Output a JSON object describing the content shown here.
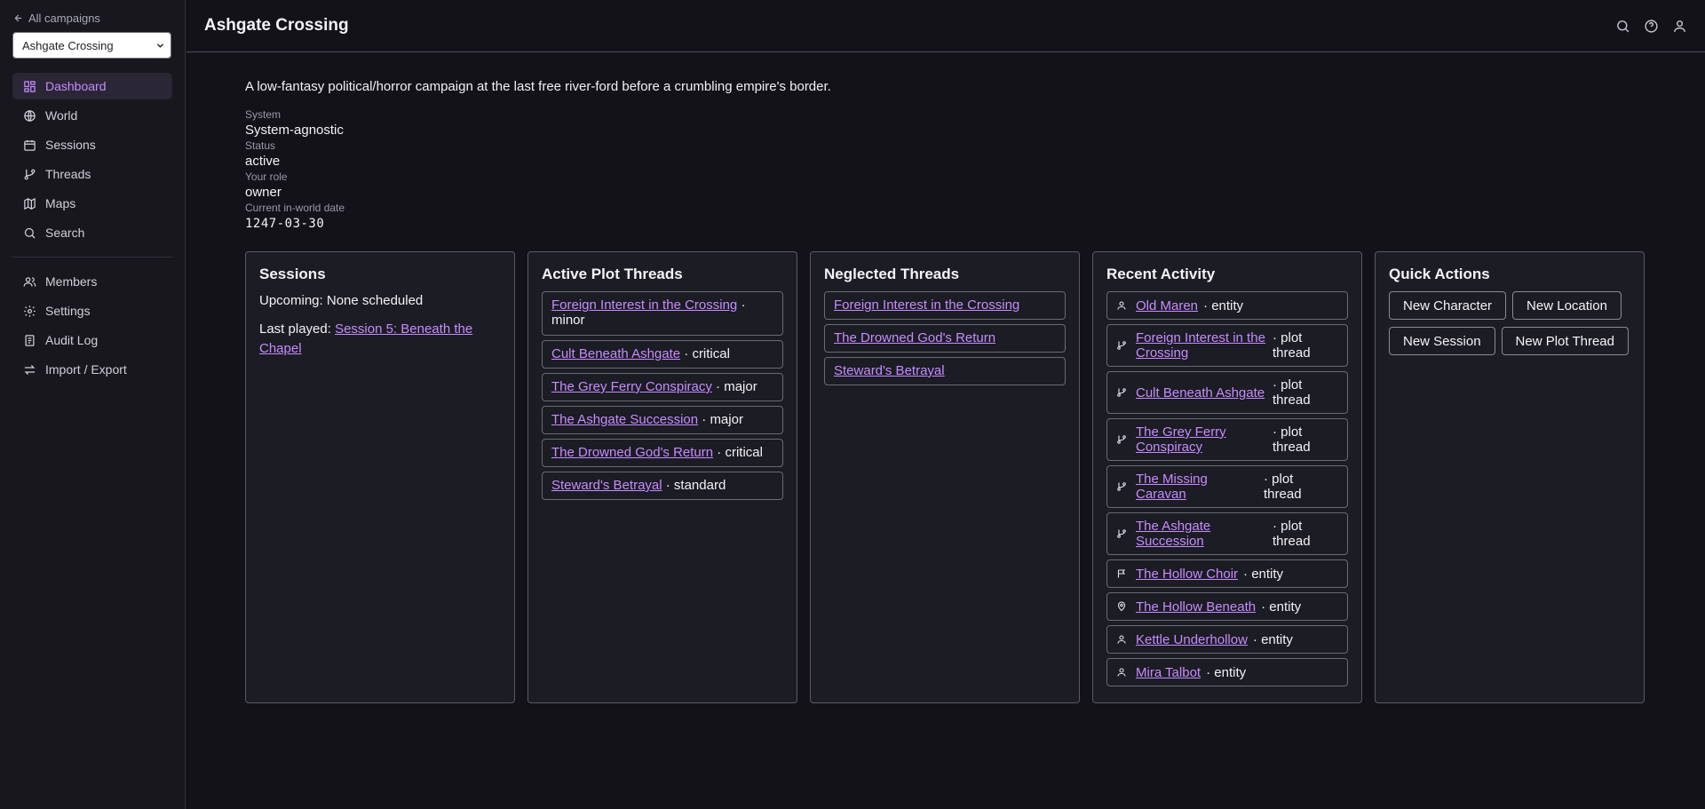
{
  "sidebar": {
    "back_label": "All campaigns",
    "campaign_select": "Ashgate Crossing",
    "nav": [
      {
        "label": "Dashboard",
        "icon": "dashboard-icon",
        "active": true
      },
      {
        "label": "World",
        "icon": "globe-icon"
      },
      {
        "label": "Sessions",
        "icon": "calendar-icon"
      },
      {
        "label": "Threads",
        "icon": "git-branch-icon"
      },
      {
        "label": "Maps",
        "icon": "map-icon"
      },
      {
        "label": "Search",
        "icon": "search-icon"
      }
    ],
    "nav2": [
      {
        "label": "Members",
        "icon": "users-icon"
      },
      {
        "label": "Settings",
        "icon": "gear-icon"
      },
      {
        "label": "Audit Log",
        "icon": "log-icon"
      },
      {
        "label": "Import / Export",
        "icon": "arrows-icon"
      }
    ]
  },
  "header": {
    "title": "Ashgate Crossing",
    "icons": [
      "search-icon",
      "help-icon",
      "user-icon"
    ]
  },
  "main": {
    "description": "A low-fantasy political/horror campaign at the last free river-ford before a crumbling empire's border.",
    "meta": [
      {
        "label": "System",
        "value": "System-agnostic"
      },
      {
        "label": "Status",
        "value": "active"
      },
      {
        "label": "Your role",
        "value": "owner"
      },
      {
        "label": "Current in-world date",
        "value": "1247-03-30"
      }
    ]
  },
  "sessions": {
    "title": "Sessions",
    "upcoming": "Upcoming: None scheduled",
    "last_played_label": "Last played: ",
    "last_played_link": "Session 5: Beneath the Chapel"
  },
  "active_threads": {
    "title": "Active Plot Threads",
    "items": [
      {
        "name": "Foreign Interest in the Crossing",
        "suffix": " · minor"
      },
      {
        "name": "Cult Beneath Ashgate",
        "suffix": " · critical"
      },
      {
        "name": "The Grey Ferry Conspiracy",
        "suffix": " · major"
      },
      {
        "name": "The Ashgate Succession",
        "suffix": " · major"
      },
      {
        "name": "The Drowned God's Return",
        "suffix": " · critical"
      },
      {
        "name": "Steward's Betrayal",
        "suffix": " · standard"
      }
    ]
  },
  "neglected_threads": {
    "title": "Neglected Threads",
    "items": [
      {
        "name": "Foreign Interest in the Crossing"
      },
      {
        "name": "The Drowned God's Return"
      },
      {
        "name": "Steward's Betrayal"
      }
    ]
  },
  "recent_activity": {
    "title": "Recent Activity",
    "items": [
      {
        "icon": "person-icon",
        "name": "Old Maren",
        "suffix": "· entity"
      },
      {
        "icon": "git-branch-icon",
        "name": "Foreign Interest in the Crossing",
        "suffix": "· plot thread"
      },
      {
        "icon": "git-branch-icon",
        "name": "Cult Beneath Ashgate",
        "suffix": "· plot thread"
      },
      {
        "icon": "git-branch-icon",
        "name": "The Grey Ferry Conspiracy",
        "suffix": "· plot thread"
      },
      {
        "icon": "git-branch-icon",
        "name": "The Missing Caravan",
        "suffix": "· plot thread"
      },
      {
        "icon": "git-branch-icon",
        "name": "The Ashgate Succession",
        "suffix": "· plot thread"
      },
      {
        "icon": "flag-icon",
        "name": "The Hollow Choir",
        "suffix": "· entity"
      },
      {
        "icon": "map-pin-icon",
        "name": "The Hollow Beneath",
        "suffix": "· entity"
      },
      {
        "icon": "person-icon",
        "name": "Kettle Underhollow",
        "suffix": "· entity"
      },
      {
        "icon": "person-icon",
        "name": "Mira Talbot",
        "suffix": "· entity"
      }
    ]
  },
  "quick_actions": {
    "title": "Quick Actions",
    "buttons": [
      "New Character",
      "New Location",
      "New Session",
      "New Plot Thread"
    ]
  },
  "colors": {
    "accent": "#c68cff",
    "background": "#121218",
    "card": "#1c1c24"
  }
}
